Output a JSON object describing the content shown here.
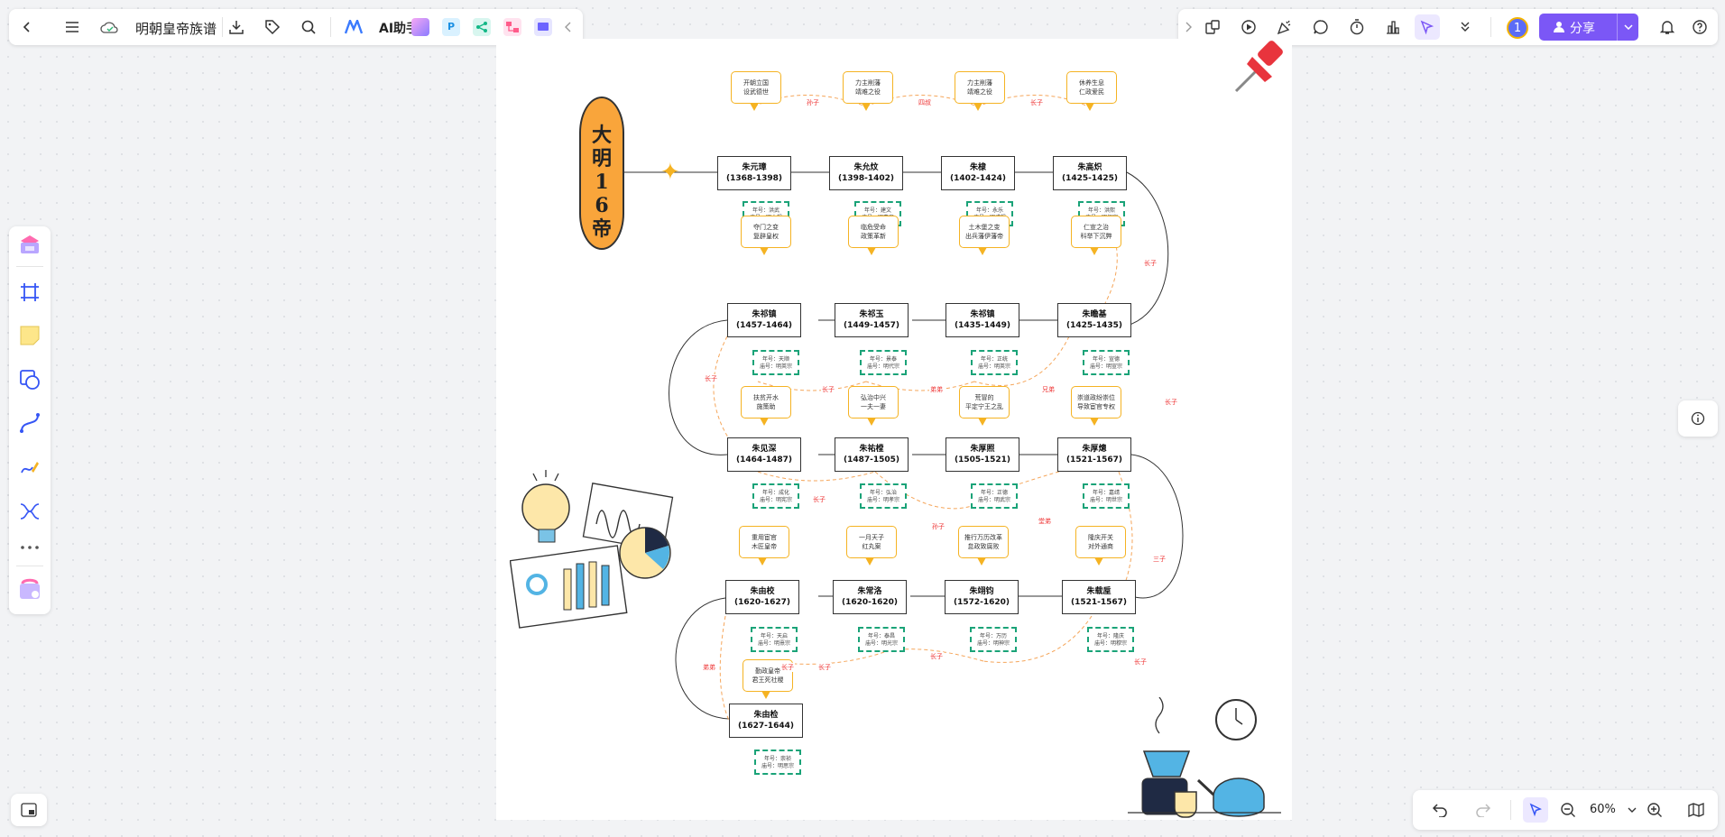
{
  "toolbar": {
    "doc_title": "明朝皇帝族谱",
    "ai_label": "AI助手",
    "share_label": "分享",
    "avatar_text": "1"
  },
  "zoom": {
    "value": "60%"
  },
  "board": {
    "title": "大明16帝",
    "row1": [
      {
        "name": "朱元璋",
        "years": "(1368-1398)",
        "event": [
          "开朝立国",
          "设武德世"
        ],
        "info": [
          "年号：洪武",
          "庙号：明太祖"
        ]
      },
      {
        "name": "朱允炆",
        "years": "(1398-1402)",
        "event": [
          "力主削藩",
          "靖难之役"
        ],
        "info": [
          "年号：建文",
          "庙号：明惠帝"
        ]
      },
      {
        "name": "朱棣",
        "years": "(1402-1424)",
        "event": [
          "力主削藩",
          "靖难之役"
        ],
        "info": [
          "年号：永乐",
          "庙号：明成祖"
        ]
      },
      {
        "name": "朱高炽",
        "years": "(1425-1425)",
        "event": [
          "休养生息",
          "仁政爱民"
        ],
        "info": [
          "年号：洪熙",
          "庙号：明仁宗"
        ]
      }
    ],
    "row2": [
      {
        "name": "朱祁镇",
        "years": "(1457-1464)",
        "event": [
          "夺门之变",
          "复辟皇权"
        ],
        "info": [
          "年号：天顺",
          "庙号：明英宗"
        ]
      },
      {
        "name": "朱祁玉",
        "years": "(1449-1457)",
        "event": [
          "临危受命",
          "政策革新"
        ],
        "info": [
          "年号：景泰",
          "庙号：明代宗"
        ]
      },
      {
        "name": "朱祁镇",
        "years": "(1435-1449)",
        "event": [
          "土木堡之变",
          "出兵藩伊藩帝"
        ],
        "info": [
          "年号：正统",
          "庙号：明英宗"
        ]
      },
      {
        "name": "朱瞻基",
        "years": "(1425-1435)",
        "event": [
          "仁宣之治",
          "科举下沉弊"
        ],
        "info": [
          "年号：宣德",
          "庙号：明宣宗"
        ]
      }
    ],
    "row3": [
      {
        "name": "朱见深",
        "years": "(1464-1487)",
        "event": [
          "扶贫开水",
          "施策助"
        ],
        "info": [
          "年号：成化",
          "庙号：明宪宗"
        ]
      },
      {
        "name": "朱祐樘",
        "years": "(1487-1505)",
        "event": [
          "弘治中兴",
          "一夫一妻"
        ],
        "info": [
          "年号：弘治",
          "庙号：明孝宗"
        ]
      },
      {
        "name": "朱厚照",
        "years": "(1505-1521)",
        "event": [
          "荒冒的",
          "平定宁王之乱"
        ],
        "info": [
          "年号：正德",
          "庙号：明武宗"
        ]
      },
      {
        "name": "朱厚熜",
        "years": "(1521-1567)",
        "event": [
          "崇道政纷崇位",
          "导致宦官专权"
        ],
        "info": [
          "年号：嘉靖",
          "庙号：明世宗"
        ]
      }
    ],
    "row4": [
      {
        "name": "朱由校",
        "years": "(1620-1627)",
        "event": [
          "重用宦官",
          "木匠皇帝"
        ],
        "info": [
          "年号：天启",
          "庙号：明熹宗"
        ]
      },
      {
        "name": "朱常洛",
        "years": "(1620-1620)",
        "event": [
          "一月天子",
          "红丸案"
        ],
        "info": [
          "年号：泰昌",
          "庙号：明光宗"
        ]
      },
      {
        "name": "朱翊钧",
        "years": "(1572-1620)",
        "event": [
          "推行万历改革",
          "怠政致腐败"
        ],
        "info": [
          "年号：万历",
          "庙号：明神宗"
        ]
      },
      {
        "name": "朱载垕",
        "years": "(1521-1567)",
        "event": [
          "隆庆开关",
          "对外通商"
        ],
        "info": [
          "年号：隆庆",
          "庙号：明穆宗"
        ]
      }
    ],
    "row5": [
      {
        "name": "朱由检",
        "years": "(1627-1644)",
        "event": [
          "勤政皇帝",
          "君王死社稷"
        ],
        "info": [
          "年号：崇祯",
          "庙号：明思宗"
        ]
      }
    ],
    "relations": [
      "孙子",
      "四叔",
      "长子",
      "长子",
      "长子",
      "长子",
      "弟弟",
      "兄弟",
      "长子",
      "长子",
      "孙子",
      "堂弟",
      "三子",
      "长子",
      "长子",
      "长子",
      "弟弟",
      "长子"
    ]
  }
}
